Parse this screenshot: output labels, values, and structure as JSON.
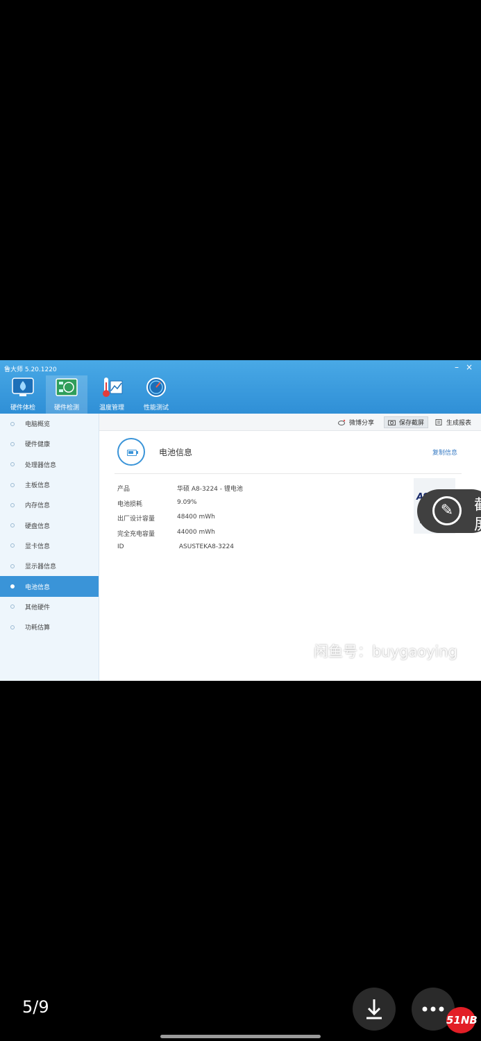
{
  "app": {
    "title": "鲁大师 5.20.1220",
    "minimize": "–",
    "close": "×"
  },
  "toolbar": [
    {
      "label": "硬件体检",
      "icon": "monitor-health-icon",
      "active": false
    },
    {
      "label": "硬件检测",
      "icon": "circuit-board-icon",
      "active": true
    },
    {
      "label": "温度管理",
      "icon": "thermometer-icon",
      "active": false
    },
    {
      "label": "性能测试",
      "icon": "speedometer-icon",
      "active": false
    }
  ],
  "sidebar": {
    "items": [
      {
        "label": "电脑概览"
      },
      {
        "label": "硬件健康"
      },
      {
        "label": "处理器信息"
      },
      {
        "label": "主板信息"
      },
      {
        "label": "内存信息"
      },
      {
        "label": "硬盘信息"
      },
      {
        "label": "显卡信息"
      },
      {
        "label": "显示器信息"
      },
      {
        "label": "电池信息",
        "active": true
      },
      {
        "label": "其他硬件"
      },
      {
        "label": "功耗估算"
      }
    ]
  },
  "actions": {
    "weibo_share": "微博分享",
    "save_screenshot": "保存截屏",
    "generate_report": "生成报表"
  },
  "section": {
    "title": "电池信息",
    "copy_info": "复制信息"
  },
  "battery": {
    "rows": [
      {
        "key": "产品",
        "value": "华硕 A8-3224 -   锂电池"
      },
      {
        "key": "电池损耗",
        "value": "9.09%"
      },
      {
        "key": "出厂设计容量",
        "value": "48400 mWh"
      },
      {
        "key": "完全充电容量",
        "value": "44000 mWh"
      },
      {
        "key": "ID",
        "value": " ASUSTEKA8-3224"
      }
    ],
    "brand_logo_text": "ASUS",
    "brand_caption": "电池"
  },
  "overlay": {
    "text": "截\n屏"
  },
  "watermark": {
    "box": "闲鱼",
    "text": "闲鱼号：buygaoying"
  },
  "viewer": {
    "page": "5/9",
    "badge": "51NB"
  },
  "colors": {
    "accent": "#3a94d8",
    "topbar": "#3a9be0",
    "sidebar_bg": "#eef6fc"
  }
}
